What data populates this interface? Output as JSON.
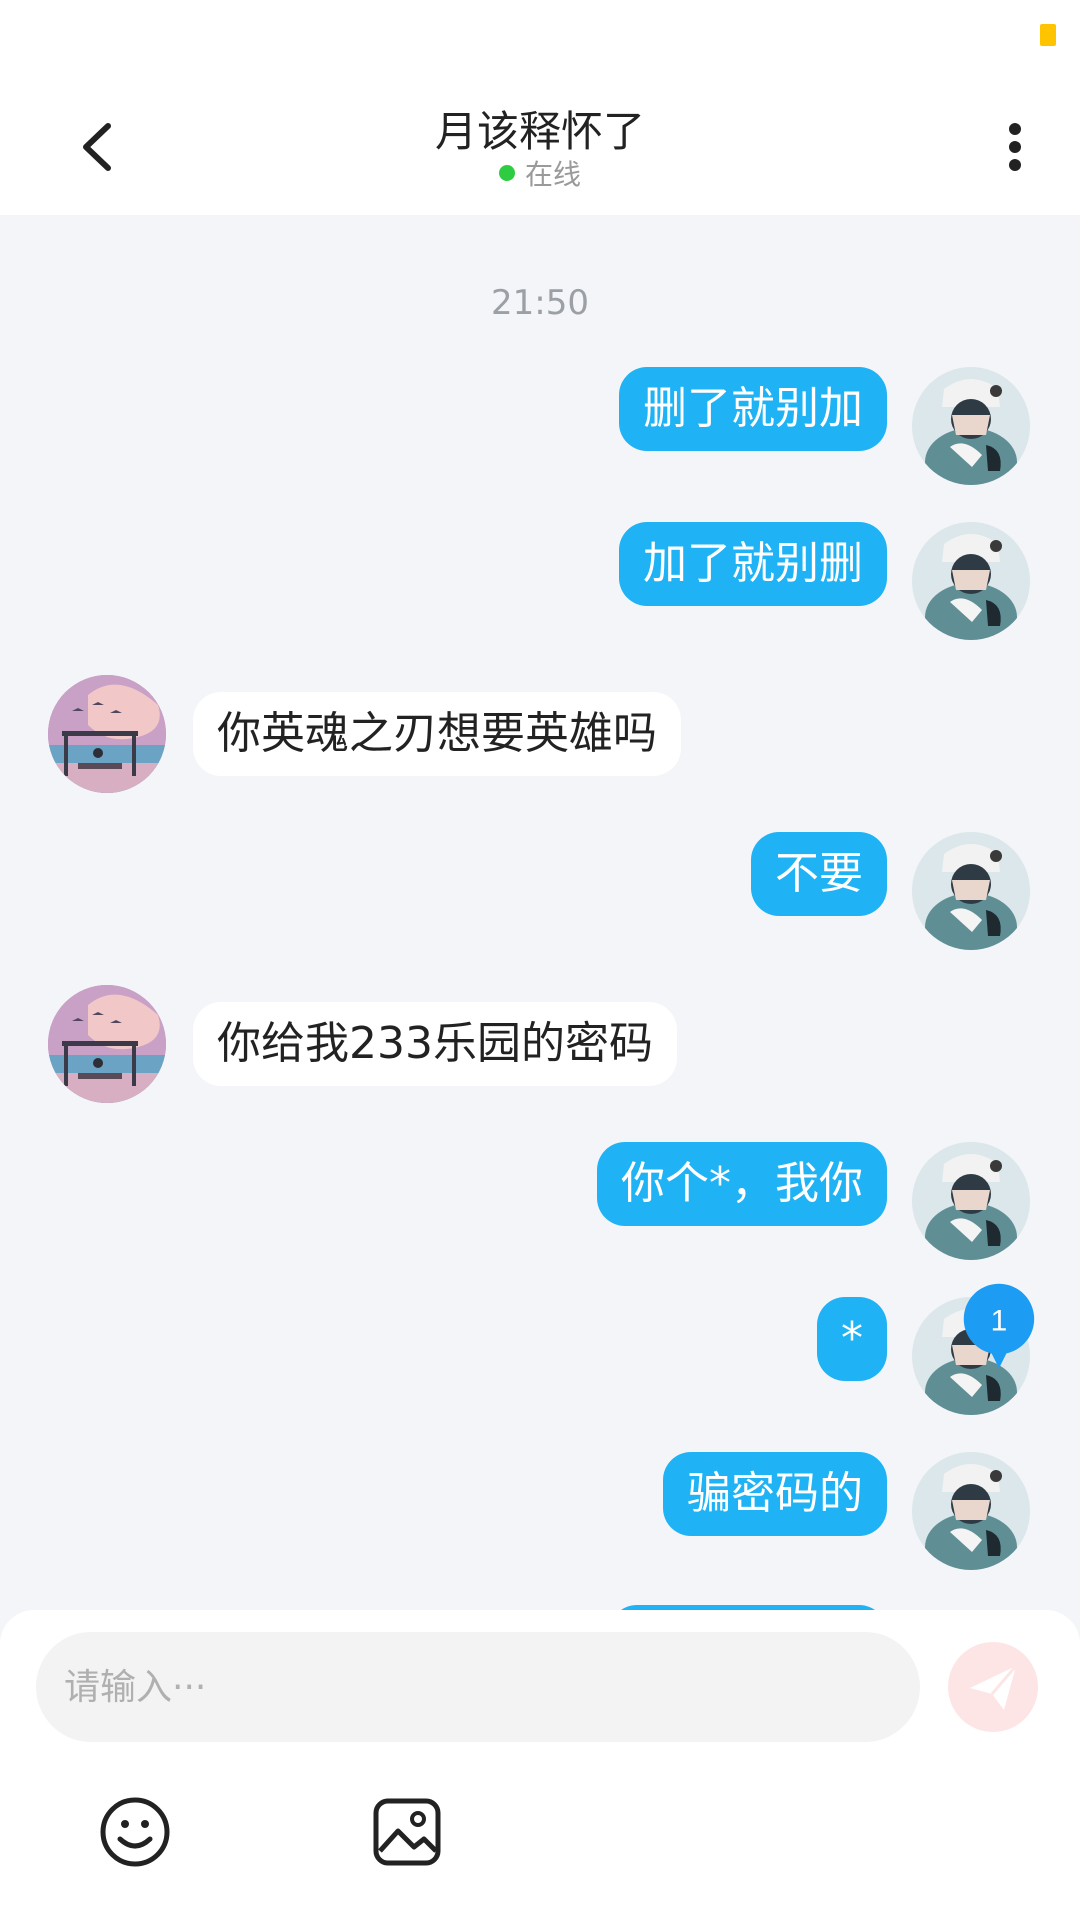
{
  "header": {
    "title": "月该释怀了",
    "status": "在线"
  },
  "chat": {
    "timestamp": "21:50",
    "messages": [
      {
        "side": "right",
        "text": "删了就别加"
      },
      {
        "side": "right",
        "text": "加了就别删"
      },
      {
        "side": "left",
        "text": "你英魂之刃想要英雄吗"
      },
      {
        "side": "right",
        "text": "不要"
      },
      {
        "side": "left",
        "text": "你给我233乐园的密码"
      },
      {
        "side": "right",
        "text": "你个*，我你"
      },
      {
        "side": "right",
        "text": "*"
      },
      {
        "side": "right",
        "text": "骗密码的"
      }
    ]
  },
  "unread_badge": "1",
  "composer": {
    "placeholder": "请输入···"
  },
  "colors": {
    "outgoing_bubble": "#1fb3f5",
    "incoming_bubble": "#ffffff",
    "online_dot": "#2ecc40",
    "send_button": "#fde5e5",
    "badge": "#1c9cf2"
  },
  "icons": {
    "back": "chevron-left-icon",
    "more": "more-vertical-icon",
    "send": "send-plane-icon",
    "emoji": "smiley-icon",
    "image": "image-icon"
  }
}
